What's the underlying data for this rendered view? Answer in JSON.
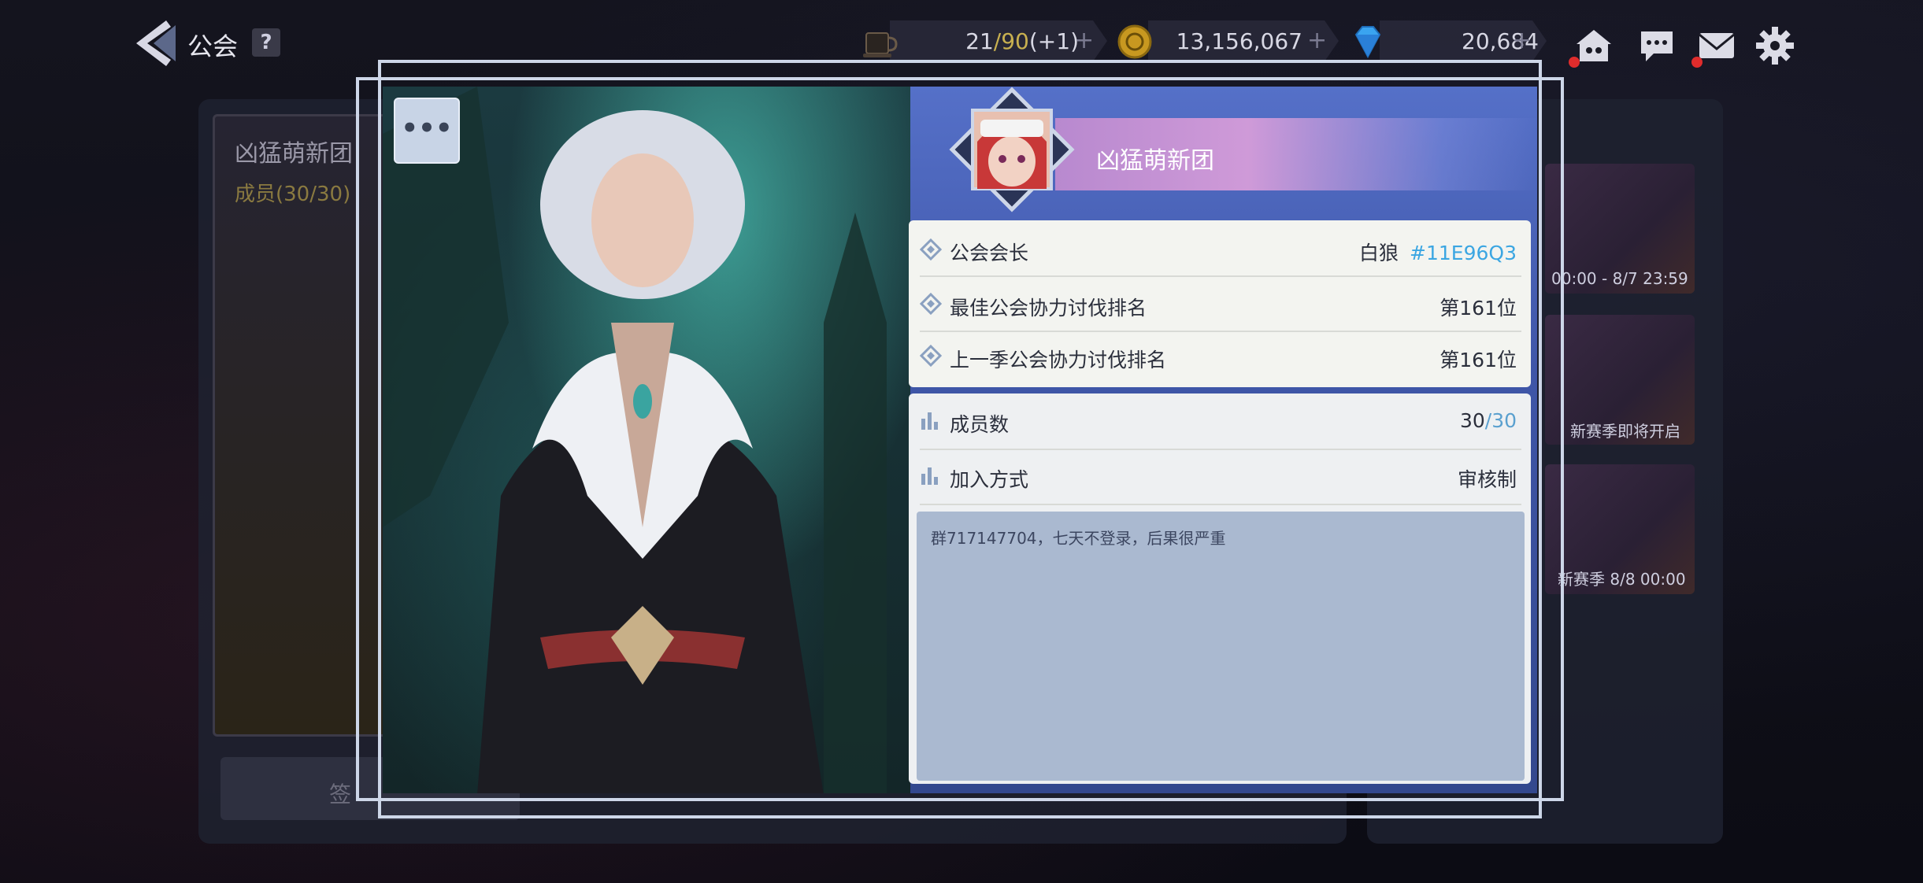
{
  "top_bar": {
    "title": "公会",
    "help_label": "?",
    "stamina": {
      "current": "21",
      "max": "90",
      "bonus": "(+1)",
      "icon": "coffee-cup-icon"
    },
    "gold": {
      "value": "13,156,067",
      "icon": "gold-coin-icon"
    },
    "gems": {
      "value": "20,684",
      "icon": "blue-gem-icon"
    },
    "plus": "+"
  },
  "background_panel": {
    "guild_name": "凶猛萌新团",
    "members": "成员(30/30)",
    "checkin_label": "签",
    "events": [
      {
        "caption": "00:00 - 8/7 23:59"
      },
      {
        "caption": "新赛季即将开启"
      },
      {
        "caption": "新赛季  8/8  00:00"
      }
    ]
  },
  "modal": {
    "more_label": "•••",
    "guild_name": "凶猛萌新团",
    "rows": [
      {
        "label": "公会会长",
        "value": "白狼",
        "id": "#11E96Q3"
      },
      {
        "label": "最佳公会协力讨伐排名",
        "value": "第161位"
      },
      {
        "label": "上一季公会协力讨伐排名",
        "value": "第161位"
      }
    ],
    "member_row": {
      "label": "成员数",
      "current": "30",
      "max": "/30"
    },
    "join_row": {
      "label": "加入方式",
      "value": "审核制"
    },
    "notice": "群717147704，七天不登录，后果很严重"
  },
  "colors": {
    "accent_blue": "#3ba6e2",
    "stamina_gold": "#c8b050",
    "panel_blue": "#4b63b8"
  }
}
